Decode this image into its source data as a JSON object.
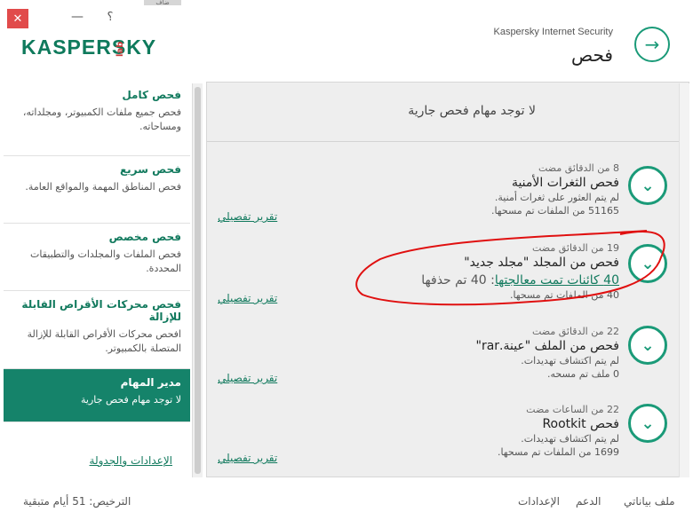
{
  "window": {
    "close_glyph": "✕",
    "minimize_glyph": "—",
    "help_glyph": "؟",
    "strip_text": "ضاف"
  },
  "header": {
    "logo_text": "KASPERSKY",
    "logo_suffix": "lab",
    "product_name": "Kaspersky Internet Security",
    "page_title": "فحص",
    "nav_glyph": "→"
  },
  "sidebar": {
    "items": [
      {
        "title": "فحص كامل",
        "desc": "فحص جميع ملفات الكمبيوتر، ومجلداته، ومساحاته."
      },
      {
        "title": "فحص سريع",
        "desc": "فحص المناطق المهمة والمواقع العامة."
      },
      {
        "title": "فحص مخصص",
        "desc": "فحص الملفات والمجلدات والتطبيقات المحددة."
      },
      {
        "title": "فحص محركات الأقراص القابلة للإزالة",
        "desc": "افحص محركات الأقراص القابلة للإزالة المتصلة بالكمبيوتر."
      },
      {
        "title": "مدير المهام",
        "desc": "لا توجد مهام فحص جارية"
      }
    ],
    "settings_link": "الإعدادات والجدولة"
  },
  "main": {
    "no_tasks": "لا توجد مهام فحص جارية",
    "tasks": [
      {
        "time": "8 من الدقائق مضت",
        "name": "فحص الثغرات الأمنية",
        "line1": "لم يتم العثور على ثغرات أمنية.",
        "line2": "51165 من الملفات تم مسحها.",
        "report": "تقرير تفصيلي"
      },
      {
        "time": "19 من الدقائق مضت",
        "name": "فحص من المجلد \"مجلد جديد\"",
        "link": "40 كائنات تمت معالجتها",
        "link_rest": ": 40 تم حذفها",
        "line2": "40 من الملفات تم مسحها.",
        "report": "تقرير تفصيلي"
      },
      {
        "time": "22 من الدقائق مضت",
        "name": "فحص من الملف \"عينة.rar\"",
        "line1": "لم يتم اكتشاف تهديدات.",
        "line2": "0 ملف تم مسحه.",
        "report": "تقرير تفصيلي"
      },
      {
        "time": "22 من الساعات مضت",
        "name": "فحص Rootkit",
        "line1": "لم يتم اكتشاف تهديدات.",
        "line2": "1699 من الملفات تم مسحها.",
        "report": "تقرير تفصيلي"
      }
    ],
    "task_icon_glyph": "⌄",
    "annotation_color": "#e01010"
  },
  "footer": {
    "license": "الترخيص: 51 أيام متبقية",
    "settings": "الإعدادات",
    "support": "الدعم",
    "my_profile": "ملف بياناتي"
  },
  "colors": {
    "brand_green": "#15836a",
    "accent_green": "#1a9a78",
    "close_red": "#e14b4b"
  }
}
